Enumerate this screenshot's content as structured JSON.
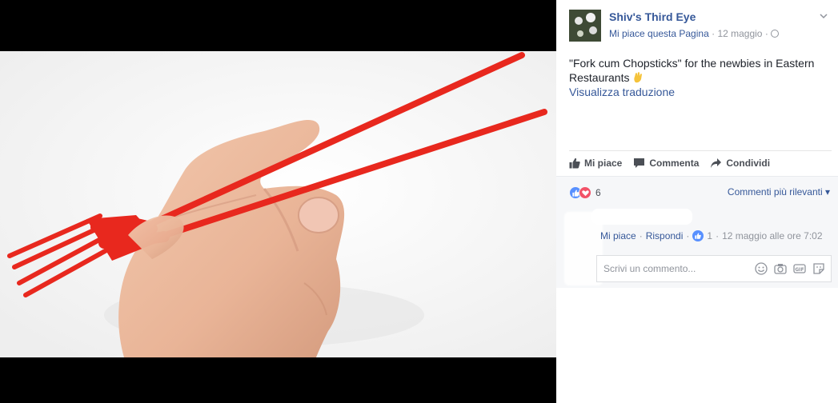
{
  "post": {
    "page_name": "Shiv's Third Eye",
    "like_page": "Mi piace questa Pagina",
    "date": "12 maggio",
    "separator": "·",
    "text": "\"Fork cum Chopsticks\" for the newbies in Eastern Restaurants",
    "see_translation": "Visualizza traduzione"
  },
  "actions": {
    "like": "Mi piace",
    "comment": "Commenta",
    "share": "Condividi"
  },
  "reactions": {
    "count": "6",
    "sort_label": "Commenti più rilevanti"
  },
  "comment": {
    "like": "Mi piace",
    "reply": "Rispondi",
    "likes": "1",
    "timestamp": "12 maggio alle ore 7:02"
  },
  "composer": {
    "placeholder": "Scrivi un commento..."
  },
  "icons": {
    "like": "thumbs-up-icon",
    "comment": "speech-bubble-icon",
    "share": "share-arrow-icon",
    "privacy": "globe-icon",
    "emoji": "smiley-icon",
    "camera": "camera-icon",
    "gif": "gif-icon",
    "sticker": "sticker-icon"
  },
  "colors": {
    "link": "#365899",
    "fork": "#e8281e",
    "like_blue": "#5890ff",
    "love_red": "#f25268"
  }
}
